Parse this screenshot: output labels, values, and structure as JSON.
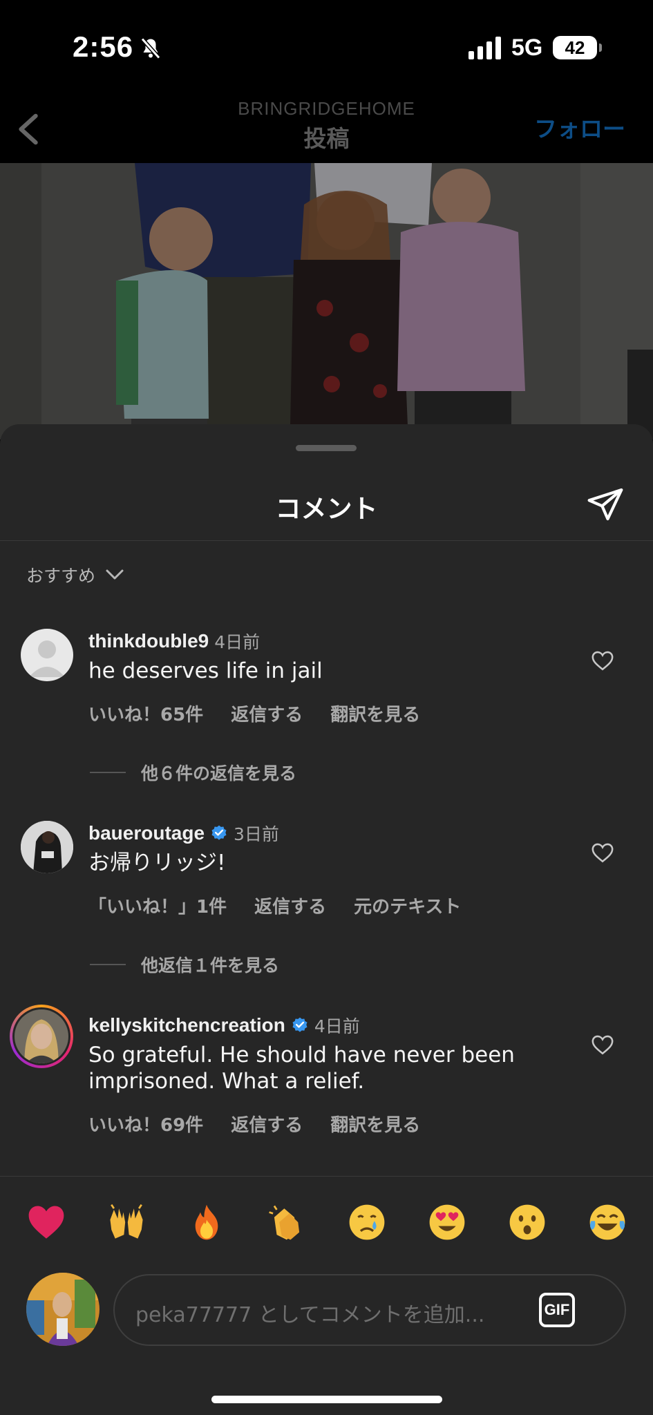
{
  "status_bar": {
    "time": "2:56",
    "network": "5G",
    "battery": "42"
  },
  "header": {
    "account": "BRINGRIDGEHOME",
    "title": "投稿",
    "follow_label": "フォロー"
  },
  "sheet": {
    "title": "コメント",
    "sort_label": "おすすめ"
  },
  "comments": [
    {
      "username": "thinkdouble9",
      "time": "4日前",
      "text": "he deserves life in jail",
      "likes": "いいね！65件",
      "reply": "返信する",
      "translate": "翻訳を見る",
      "replies_link": "他６件の返信を見る",
      "verified": false
    },
    {
      "username": "baueroutage",
      "time": "3日前",
      "text": "お帰りリッジ!",
      "likes": "「いいね！」1件",
      "reply": "返信する",
      "translate": "元のテキスト",
      "replies_link": "他返信１件を見る",
      "verified": true
    },
    {
      "username": "kellyskitchencreation",
      "time": "4日前",
      "text": "So grateful. He should have never been imprisoned. What a relief.",
      "likes": "いいね！69件",
      "reply": "返信する",
      "translate": "翻訳を見る",
      "verified": true
    }
  ],
  "emojis": [
    "red-heart",
    "raising-hands",
    "fire",
    "clapping-hands",
    "crying-face",
    "heart-eyes",
    "astonished-face",
    "tears-of-joy"
  ],
  "input": {
    "placeholder": "peka77777 としてコメントを追加...",
    "gif_label": "GIF"
  },
  "colors": {
    "sheet_bg": "#262626",
    "follow_blue": "#0d4d86",
    "verified_blue": "#3897f0",
    "muted_text": "#a8a8a8"
  }
}
